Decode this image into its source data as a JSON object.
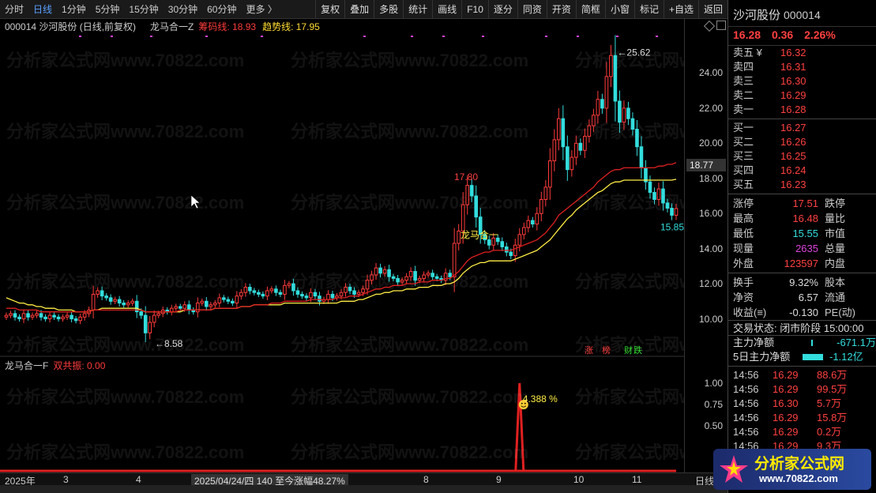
{
  "toolbar": {
    "left": [
      "分时",
      "日线",
      "1分钟",
      "5分钟",
      "15分钟",
      "30分钟",
      "60分钟",
      "更多 〉"
    ],
    "active_index": 1,
    "right": [
      "复权",
      "叠加",
      "多股",
      "统计",
      "画线",
      "F10",
      "逐分",
      "同资",
      "开资",
      "简框",
      "小窗",
      "标记",
      "+自选",
      "返回"
    ]
  },
  "chart_header": {
    "code": "000014 沙河股份 (日线,前复权)",
    "indicator": "龙马合一Z",
    "chip_line_label": "筹码线: 18.93",
    "trend_line_label": "趋势线: 17.95"
  },
  "main_axis": {
    "ticks": [
      "24.00",
      "22.00",
      "20.00",
      "18.00",
      "16.00",
      "14.00",
      "12.00",
      "10.00"
    ],
    "current_price": "18.77"
  },
  "annotations": {
    "high": "25.62",
    "low": "8.58",
    "mid_high": "17.80",
    "last_low": "15.85",
    "signal_text": "龙马合一",
    "tags": [
      "涨",
      "榜",
      "财",
      "跌"
    ]
  },
  "sub_header": {
    "indicator": "龙马合一F",
    "value_label": "双共振: 0.00"
  },
  "sub_axis": {
    "ticks": [
      "1.00",
      "0.75",
      "0.50"
    ]
  },
  "sub_annotation": {
    "pct": "4.388 %"
  },
  "bottom_axis": {
    "labels": [
      "2025年",
      "3",
      "4",
      "2025/04/24/四  140 至今涨幅48.27%",
      "8",
      "9",
      "10",
      "11"
    ],
    "right_label": "日线"
  },
  "watermark": "分析家公式网www.70822.com",
  "stock": {
    "name": "沙河股份",
    "code": "000014",
    "price": "16.28",
    "change": "0.36",
    "change_pct": "2.26%"
  },
  "orderbook": {
    "asks": [
      {
        "label": "卖五 ¥",
        "price": "16.32"
      },
      {
        "label": "卖四",
        "price": "16.31"
      },
      {
        "label": "卖三",
        "price": "16.30"
      },
      {
        "label": "卖二",
        "price": "16.29"
      },
      {
        "label": "卖一",
        "price": "16.28"
      }
    ],
    "bids": [
      {
        "label": "买一",
        "price": "16.27"
      },
      {
        "label": "买二",
        "price": "16.26"
      },
      {
        "label": "买三",
        "price": "16.25"
      },
      {
        "label": "买四",
        "price": "16.24"
      },
      {
        "label": "买五",
        "price": "16.23"
      }
    ]
  },
  "stats": [
    {
      "l1": "涨停",
      "v1": "17.51",
      "c1": "red",
      "l2": "跌停"
    },
    {
      "l1": "最高",
      "v1": "16.48",
      "c1": "red",
      "l2": "量比"
    },
    {
      "l1": "最低",
      "v1": "15.55",
      "c1": "cyan",
      "l2": "市值"
    },
    {
      "l1": "现量",
      "v1": "2635",
      "c1": "magenta",
      "l2": "总量"
    },
    {
      "l1": "外盘",
      "v1": "123597",
      "c1": "red",
      "l2": "内盘"
    }
  ],
  "stats2": [
    {
      "l1": "换手",
      "v1": "9.32%",
      "c1": "white",
      "l2": "股本"
    },
    {
      "l1": "净资",
      "v1": "6.57",
      "c1": "white",
      "l2": "流通"
    },
    {
      "l1": "收益(≡)",
      "v1": "-0.130",
      "c1": "white",
      "l2": "PE(动)"
    }
  ],
  "status": {
    "label": "交易状态: 闭市阶段 15:00:00"
  },
  "flow": [
    {
      "label": "主力净额",
      "value": "-671.1万"
    },
    {
      "label": "5日主力净额",
      "value": "-1.12亿"
    }
  ],
  "ticks": [
    {
      "time": "14:56",
      "price": "16.29",
      "vol": "88.6万"
    },
    {
      "time": "14:56",
      "price": "16.29",
      "vol": "99.5万"
    },
    {
      "time": "14:56",
      "price": "16.30",
      "vol": "5.7万"
    },
    {
      "time": "14:56",
      "price": "16.29",
      "vol": "15.8万"
    },
    {
      "time": "14:56",
      "price": "16.29",
      "vol": "0.2万"
    },
    {
      "time": "14:56",
      "price": "16.29",
      "vol": "9.3万"
    }
  ],
  "logo": {
    "title": "分析家公式网",
    "url": "www.70822.com"
  },
  "chart_data": {
    "type": "candlestick",
    "ylim": [
      8,
      26
    ],
    "x_labels": [
      "2025年",
      "3",
      "4",
      "8",
      "9",
      "10",
      "11"
    ],
    "y_ticks": [
      10,
      12,
      14,
      16,
      18,
      20,
      22,
      24
    ],
    "closes": [
      10.2,
      10.3,
      10.1,
      10.0,
      10.3,
      10.1,
      10.2,
      10.3,
      10.1,
      10.0,
      10.2,
      10.1,
      10.0,
      10.1,
      10.2,
      10.0,
      9.9,
      10.1,
      10.3,
      10.5,
      11.4,
      11.6,
      11.3,
      11.2,
      11.0,
      11.1,
      10.9,
      10.8,
      10.9,
      11.0,
      10.4,
      10.2,
      9.2,
      9.8,
      10.2,
      10.3,
      10.5,
      10.4,
      10.6,
      10.7,
      10.6,
      10.8,
      10.5,
      10.4,
      10.9,
      11.0,
      10.7,
      10.8,
      10.9,
      11.2,
      11.1,
      11.0,
      10.9,
      11.3,
      11.5,
      11.8,
      11.6,
      11.5,
      11.4,
      11.3,
      11.6,
      11.7,
      11.5,
      11.4,
      11.9,
      12.0,
      11.6,
      11.4,
      11.3,
      11.2,
      11.5,
      11.3,
      11.0,
      11.1,
      11.4,
      11.2,
      11.3,
      11.5,
      11.8,
      11.6,
      11.4,
      11.5,
      11.7,
      12.2,
      12.5,
      12.9,
      12.6,
      12.8,
      12.4,
      12.3,
      12.1,
      12.2,
      12.4,
      12.7,
      12.2,
      12.3,
      12.5,
      12.6,
      12.4,
      12.3,
      12.2,
      12.6,
      12.4,
      14.3,
      15.0,
      16.5,
      17.6,
      17.0,
      15.8,
      14.8,
      14.5,
      14.2,
      14.6,
      14.4,
      14.1,
      13.8,
      13.6,
      14.2,
      14.8,
      15.2,
      15.6,
      15.4,
      16.0,
      16.8,
      17.5,
      19.0,
      20.2,
      21.4,
      19.8,
      18.5,
      19.2,
      20.0,
      19.6,
      20.4,
      21.0,
      21.6,
      22.5,
      22.0,
      23.8,
      25.0,
      22.4,
      21.2,
      22.0,
      21.4,
      20.8,
      19.8,
      18.6,
      17.8,
      17.2,
      16.8,
      17.4,
      16.6,
      16.3,
      15.9,
      16.28
    ],
    "chip_line": [
      10.6,
      10.6,
      10.6,
      10.5,
      10.5,
      10.5,
      10.5,
      10.5,
      10.4,
      10.4,
      10.4,
      10.4,
      10.4,
      10.4,
      10.4,
      10.4,
      10.4,
      10.4,
      10.4,
      10.4,
      10.5,
      10.5,
      10.5,
      10.5,
      10.5,
      10.5,
      10.5,
      10.5,
      10.5,
      10.5,
      10.5,
      10.5,
      10.4,
      10.4,
      10.4,
      10.4,
      10.4,
      10.4,
      10.4,
      10.4,
      10.5,
      10.5,
      10.5,
      10.5,
      10.5,
      10.5,
      10.5,
      10.5,
      10.6,
      10.6,
      10.6,
      10.6,
      10.6,
      10.6,
      10.7,
      10.7,
      10.7,
      10.8,
      10.8,
      10.8,
      10.8,
      10.9,
      10.9,
      10.9,
      11.0,
      11.0,
      11.0,
      11.0,
      11.0,
      11.0,
      11.1,
      11.1,
      11.1,
      11.1,
      11.1,
      11.1,
      11.2,
      11.2,
      11.2,
      11.3,
      11.3,
      11.3,
      11.4,
      11.5,
      11.6,
      11.7,
      11.7,
      11.8,
      11.8,
      11.9,
      11.9,
      11.9,
      12.0,
      12.0,
      12.0,
      12.1,
      12.1,
      12.1,
      12.2,
      12.2,
      12.2,
      12.3,
      12.3,
      12.5,
      12.7,
      13.0,
      13.3,
      13.5,
      13.6,
      13.7,
      13.8,
      13.8,
      13.9,
      13.9,
      13.9,
      13.9,
      13.9,
      14.0,
      14.1,
      14.2,
      14.3,
      14.4,
      14.5,
      14.7,
      14.9,
      15.2,
      15.5,
      15.9,
      16.1,
      16.3,
      16.5,
      16.7,
      16.9,
      17.1,
      17.3,
      17.5,
      17.8,
      18.0,
      18.2,
      18.4,
      18.5,
      18.5,
      18.6,
      18.6,
      18.6,
      18.6,
      18.6,
      18.6,
      18.6,
      18.6,
      18.7,
      18.7,
      18.8,
      18.8,
      18.9
    ],
    "trend_line": [
      11.2,
      11.1,
      11.0,
      10.9,
      10.9,
      10.8,
      10.8,
      10.7,
      10.7,
      10.6,
      10.6,
      10.6,
      10.5,
      10.5,
      10.5,
      10.5,
      10.4,
      10.4,
      10.4,
      10.4,
      10.5,
      10.5,
      10.6,
      10.6,
      10.6,
      10.6,
      10.6,
      10.6,
      10.6,
      10.6,
      10.6,
      10.5,
      10.4,
      10.4,
      10.4,
      10.4,
      10.4,
      10.4,
      10.4,
      10.4,
      10.4,
      10.5,
      10.5,
      10.5,
      10.5,
      10.5,
      10.5,
      10.5,
      10.6,
      10.6,
      10.6,
      10.6,
      10.6,
      10.6,
      10.7,
      10.7,
      10.7,
      10.8,
      10.8,
      10.8,
      10.8,
      10.8,
      10.8,
      10.8,
      10.9,
      10.9,
      10.9,
      10.9,
      10.9,
      10.9,
      10.9,
      10.9,
      10.9,
      10.9,
      10.9,
      10.9,
      10.9,
      11.0,
      11.0,
      11.0,
      11.0,
      11.1,
      11.1,
      11.2,
      11.3,
      11.4,
      11.4,
      11.5,
      11.5,
      11.6,
      11.6,
      11.6,
      11.7,
      11.7,
      11.7,
      11.8,
      11.8,
      11.8,
      11.9,
      11.9,
      11.9,
      12.0,
      12.0,
      12.1,
      12.3,
      12.6,
      12.8,
      13.0,
      13.1,
      13.2,
      13.2,
      13.3,
      13.3,
      13.3,
      13.3,
      13.3,
      13.3,
      13.4,
      13.5,
      13.6,
      13.7,
      13.8,
      13.9,
      14.1,
      14.3,
      14.5,
      14.8,
      15.1,
      15.4,
      15.7,
      15.9,
      16.2,
      16.4,
      16.6,
      16.8,
      17.0,
      17.2,
      17.3,
      17.5,
      17.7,
      17.8,
      17.8,
      17.9,
      17.9,
      17.9,
      17.9,
      17.9,
      17.9,
      17.9,
      17.9,
      17.9,
      17.9,
      17.9,
      17.9,
      17.95
    ],
    "sub_spike_index": 118,
    "sub_ylim": [
      0,
      1.1
    ]
  }
}
